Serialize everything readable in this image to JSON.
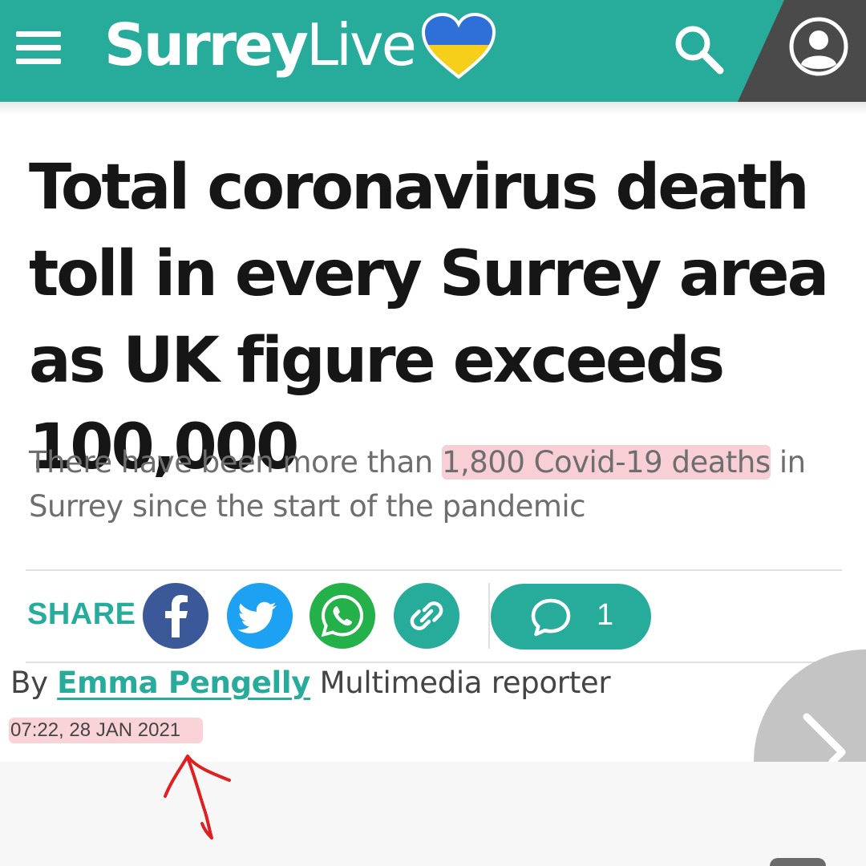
{
  "header": {
    "brand_bold": "Surrey",
    "brand_light": "Live",
    "colors": {
      "brand_teal": "#27ab9b",
      "dark_panel": "#4a4a4a"
    }
  },
  "icons": [
    "menu-icon",
    "ukraine-heart-icon",
    "search-icon",
    "account-icon",
    "facebook-icon",
    "twitter-icon",
    "whatsapp-icon",
    "link-icon",
    "comment-icon",
    "chevron-right-icon"
  ],
  "article": {
    "headline": "Total coronavirus death toll in every Surrey area as UK figure exceeds 100,000",
    "standfirst_before": "There have been more than ",
    "standfirst_highlight": "1,800 Covid-19 deaths",
    "standfirst_after": " in Surrey since the start of the pandemic",
    "byline_prefix": "By ",
    "author": "Emma Pengelly",
    "author_role": " Multimedia reporter",
    "timestamp": "07:22, 28 JAN 2021"
  },
  "share": {
    "label": "SHARE",
    "comment_count": "1",
    "colors": {
      "facebook": "#3b5998",
      "twitter": "#1da1f2",
      "whatsapp": "#25b14a",
      "link": "#27ab9b"
    }
  },
  "annotations": {
    "highlight_color": "#f3a8b2",
    "arrow_color": "#e02020"
  }
}
